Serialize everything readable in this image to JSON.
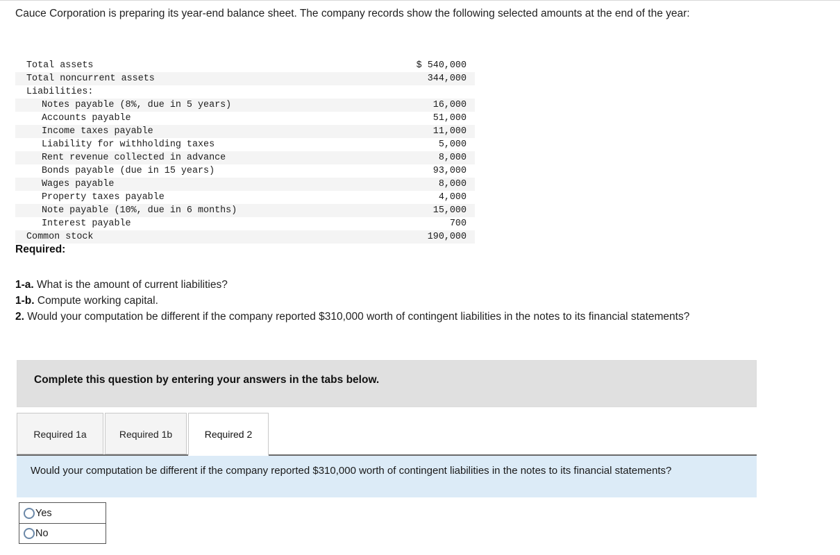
{
  "intro": {
    "text": "Cauce Corporation is preparing its year-end balance sheet. The company records show the following selected amounts at the end of the year:"
  },
  "data_table": {
    "rows": [
      {
        "label": "Total assets",
        "indent": 0,
        "amount": "$ 540,000"
      },
      {
        "label": "Total noncurrent assets",
        "indent": 0,
        "amount": "344,000"
      },
      {
        "label": "Liabilities:",
        "indent": 0,
        "amount": ""
      },
      {
        "label": "Notes payable (8%, due in 5 years)",
        "indent": 1,
        "amount": "16,000"
      },
      {
        "label": "Accounts payable",
        "indent": 1,
        "amount": "51,000"
      },
      {
        "label": "Income taxes payable",
        "indent": 1,
        "amount": "11,000"
      },
      {
        "label": "Liability for withholding taxes",
        "indent": 1,
        "amount": "5,000"
      },
      {
        "label": "Rent revenue collected in advance",
        "indent": 1,
        "amount": "8,000"
      },
      {
        "label": "Bonds payable (due in 15 years)",
        "indent": 1,
        "amount": "93,000"
      },
      {
        "label": "Wages payable",
        "indent": 1,
        "amount": "8,000"
      },
      {
        "label": "Property taxes payable",
        "indent": 1,
        "amount": "4,000"
      },
      {
        "label": "Note payable (10%, due in 6 months)",
        "indent": 1,
        "amount": "15,000"
      },
      {
        "label": "Interest payable",
        "indent": 1,
        "amount": "700"
      },
      {
        "label": "Common stock",
        "indent": 0,
        "amount": "190,000"
      }
    ]
  },
  "required": {
    "heading": "Required:",
    "items": [
      {
        "num": "1-a.",
        "text": " What is the amount of current liabilities?"
      },
      {
        "num": "1-b.",
        "text": " Compute working capital."
      },
      {
        "num": "2.",
        "text": " Would your computation be different if the company reported $310,000 worth of contingent liabilities in the notes to its financial statements?"
      }
    ]
  },
  "instruction_banner": {
    "text": "Complete this question by entering your answers in the tabs below."
  },
  "tabs": {
    "items": [
      {
        "label": "Required 1a",
        "active": false
      },
      {
        "label": "Required 1b",
        "active": false
      },
      {
        "label": "Required 2",
        "active": true
      }
    ]
  },
  "question_panel": {
    "text": "Would your computation be different if the company reported $310,000 worth of contingent liabilities in the notes to its financial statements?"
  },
  "answer": {
    "options": [
      {
        "label": "Yes",
        "selected": false
      },
      {
        "label": "No",
        "selected": false
      }
    ]
  },
  "colors": {
    "banner_gray": "#e0e0e0",
    "panel_blue": "#dcebf7",
    "stripe": "#f4f4f4",
    "radio_border": "#6b88a8",
    "tab_inactive": "#f4f4f4"
  }
}
